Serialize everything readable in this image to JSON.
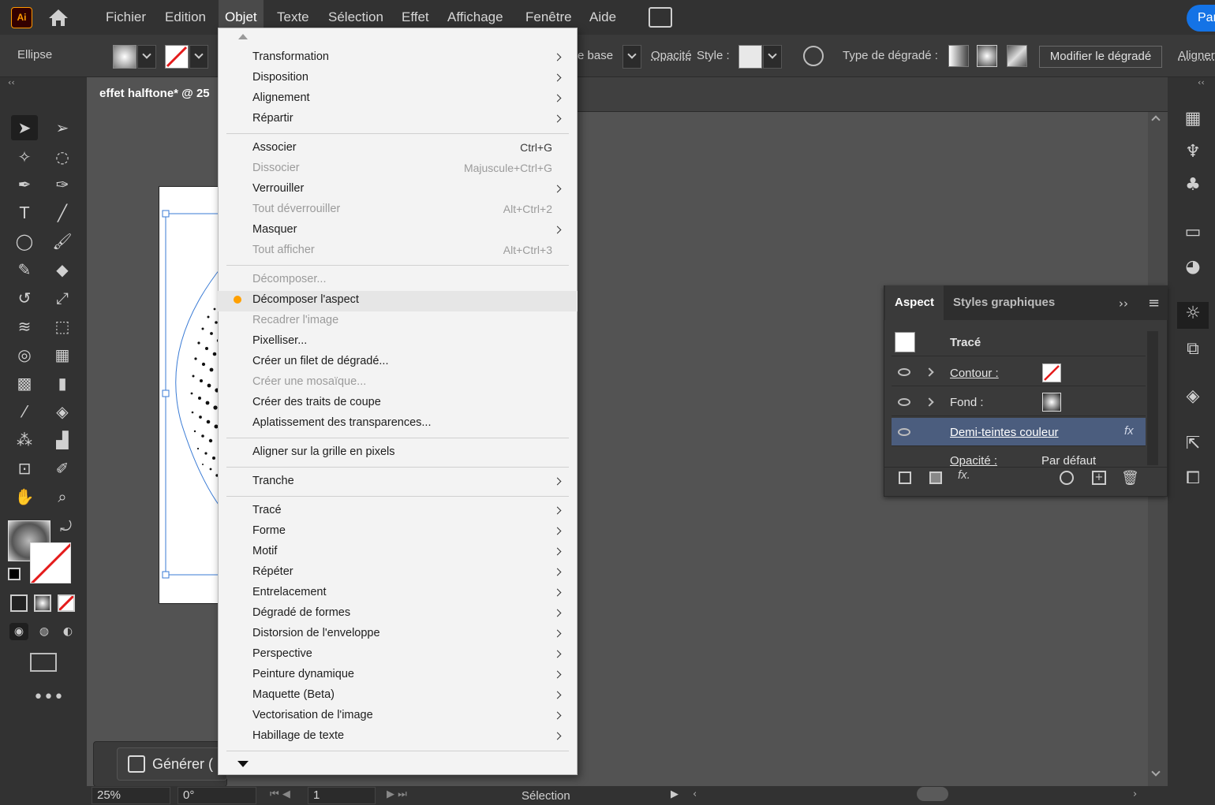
{
  "app": {
    "logo_text": "Ai",
    "share_label": "Par"
  },
  "menubar": {
    "items": [
      "Fichier",
      "Edition",
      "Objet",
      "Texte",
      "Sélection",
      "Effet",
      "Affichage",
      "Fenêtre",
      "Aide"
    ],
    "active": "Objet"
  },
  "controlbar": {
    "object_type": "Ellipse",
    "style_partial": "e base",
    "opacity_label": "Opacité",
    "style_label": "Style :",
    "gradient_type_label": "Type de dégradé :",
    "edit_gradient_label": "Modifier le dégradé",
    "align_label": "Aligner"
  },
  "document": {
    "tab_title": "effet halftone* @ 25"
  },
  "objet_menu": {
    "items": [
      {
        "label": "Transformation",
        "submenu": true
      },
      {
        "label": "Disposition",
        "submenu": true
      },
      {
        "label": "Alignement",
        "submenu": true
      },
      {
        "label": "Répartir",
        "submenu": true
      },
      {
        "label": "Associer",
        "shortcut": "Ctrl+G"
      },
      {
        "label": "Dissocier",
        "shortcut": "Majuscule+Ctrl+G",
        "disabled": true
      },
      {
        "label": "Verrouiller",
        "submenu": true
      },
      {
        "label": "Tout déverrouiller",
        "shortcut": "Alt+Ctrl+2",
        "disabled": true
      },
      {
        "label": "Masquer",
        "submenu": true
      },
      {
        "label": "Tout afficher",
        "shortcut": "Alt+Ctrl+3",
        "disabled": true
      },
      {
        "label": "Décomposer...",
        "disabled": true
      },
      {
        "label": "Décomposer l'aspect",
        "hover": true
      },
      {
        "label": "Recadrer l'image",
        "disabled": true
      },
      {
        "label": "Pixelliser..."
      },
      {
        "label": "Créer un filet de dégradé..."
      },
      {
        "label": "Créer une mosaïque...",
        "disabled": true
      },
      {
        "label": "Créer des traits de coupe"
      },
      {
        "label": "Aplatissement des transparences..."
      },
      {
        "label": "Aligner sur la grille en pixels"
      },
      {
        "label": "Tranche",
        "submenu": true
      },
      {
        "label": "Tracé",
        "submenu": true
      },
      {
        "label": "Forme",
        "submenu": true
      },
      {
        "label": "Motif",
        "submenu": true
      },
      {
        "label": "Répéter",
        "submenu": true
      },
      {
        "label": "Entrelacement",
        "submenu": true
      },
      {
        "label": "Dégradé de formes",
        "submenu": true
      },
      {
        "label": "Distorsion de l'enveloppe",
        "submenu": true
      },
      {
        "label": "Perspective",
        "submenu": true
      },
      {
        "label": "Peinture dynamique",
        "submenu": true
      },
      {
        "label": "Maquette (Beta)",
        "submenu": true
      },
      {
        "label": "Vectorisation de l'image",
        "submenu": true
      },
      {
        "label": "Habillage de texte",
        "submenu": true
      }
    ]
  },
  "aspect_panel": {
    "tabs": [
      "Aspect",
      "Styles graphiques"
    ],
    "header": "Tracé",
    "rows": {
      "stroke": "Contour :",
      "fill": "Fond :",
      "effect": "Demi-teintes couleur",
      "effect_fx": "fx",
      "opacity": "Opacité :",
      "opacity_value": "Par défaut"
    },
    "footer_fx": "fx."
  },
  "statusbar": {
    "zoom": "25%",
    "rotation": "0°",
    "artboard": "1",
    "tool": "Sélection"
  },
  "generate": {
    "label": "Générer ("
  },
  "colors": {
    "accent": "#1473e6",
    "hover_dot": "#ffa000",
    "highlight_row": "#4b5d7e"
  }
}
